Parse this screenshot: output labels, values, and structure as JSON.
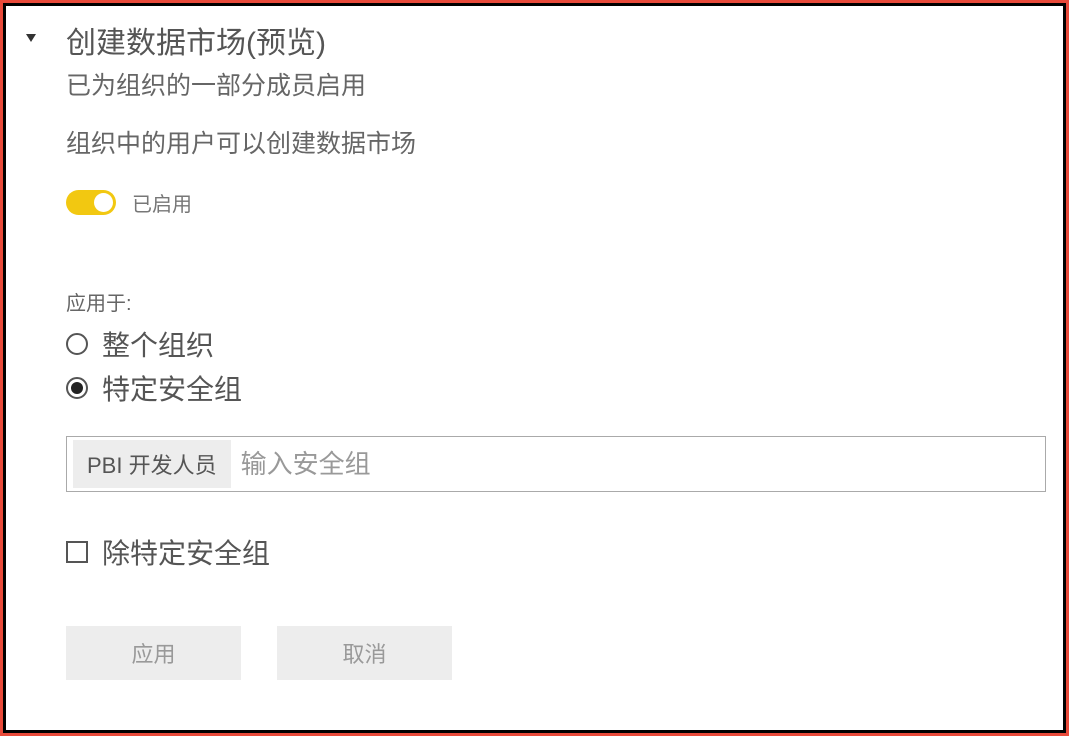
{
  "setting": {
    "title": "创建数据市场(预览)",
    "subtitle": "已为组织的一部分成员启用",
    "description": "组织中的用户可以创建数据市场",
    "toggle": {
      "enabled": true,
      "label": "已启用"
    },
    "applies_to": {
      "label": "应用于:",
      "options": [
        {
          "value": "entire_org",
          "label": "整个组织",
          "selected": false
        },
        {
          "value": "specific_groups",
          "label": "特定安全组",
          "selected": true
        }
      ]
    },
    "security_groups": {
      "chips": [
        "PBI 开发人员"
      ],
      "placeholder": "输入安全组"
    },
    "except_groups": {
      "checked": false,
      "label": "除特定安全组"
    },
    "buttons": {
      "apply": "应用",
      "cancel": "取消"
    }
  },
  "colors": {
    "accent": "#f2c811",
    "frame_outer": "#e84a3a"
  }
}
